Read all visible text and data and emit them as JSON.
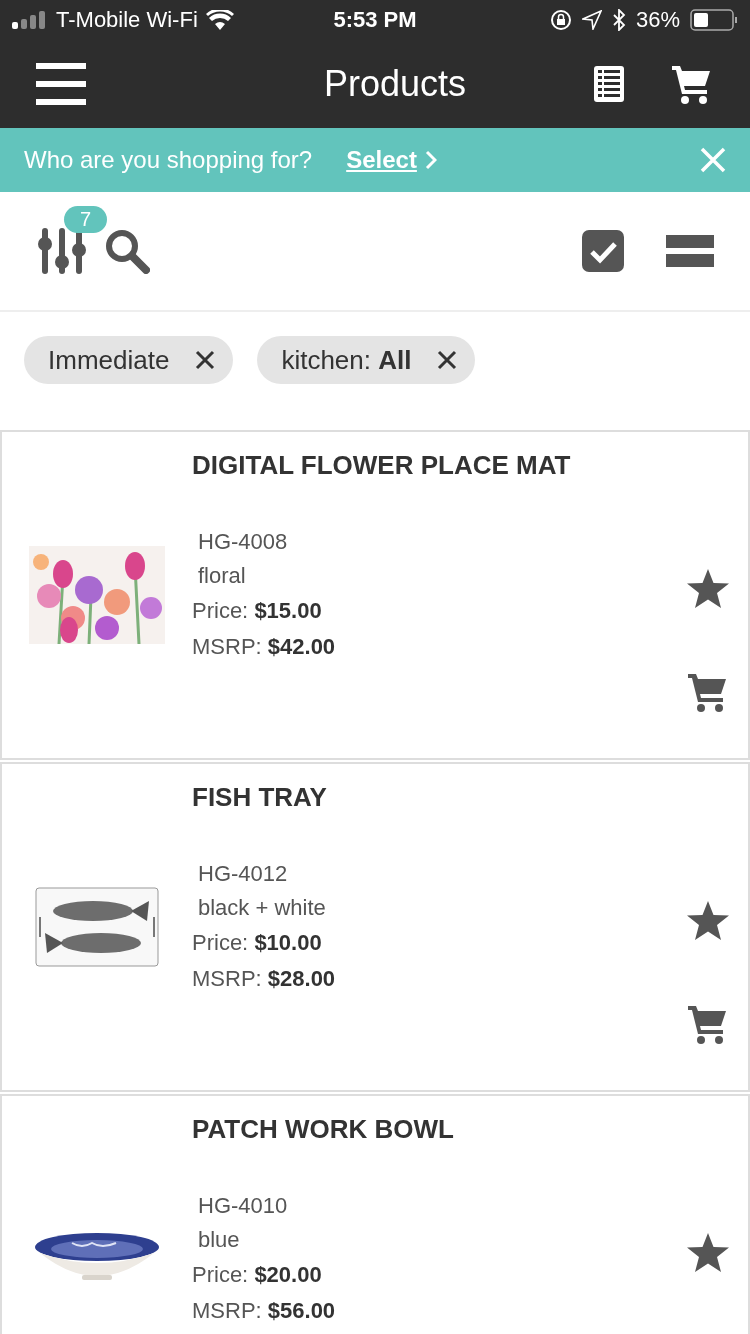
{
  "status_bar": {
    "carrier": "T-Mobile Wi-Fi",
    "time": "5:53 PM",
    "battery": "36%"
  },
  "nav": {
    "title": "Products"
  },
  "banner": {
    "text": "Who are you shopping for?",
    "link": "Select"
  },
  "toolbar": {
    "filter_count": "7",
    "select_mode": {
      "checked": true
    }
  },
  "chips": [
    {
      "label": "Immediate"
    },
    {
      "label": "kitchen: **All**"
    }
  ],
  "products": [
    {
      "name": "DIGITAL FLOWER PLACE MAT",
      "sku": "HG-4008",
      "color_name": "floral",
      "price_label": "Price:",
      "price": "$15.00",
      "msrp_label": "MSRP:",
      "msrp": "$42.00"
    },
    {
      "name": "FISH TRAY",
      "sku": "HG-4012",
      "color_name": "black + white",
      "price_label": "Price:",
      "price": "$10.00",
      "msrp_label": "MSRP:",
      "msrp": "$28.00"
    },
    {
      "name": "PATCH WORK BOWL",
      "sku": "HG-4010",
      "color_name": "blue",
      "price_label": "Price:",
      "price": "$20.00",
      "msrp_label": "MSRP:",
      "msrp": "$56.00"
    }
  ]
}
